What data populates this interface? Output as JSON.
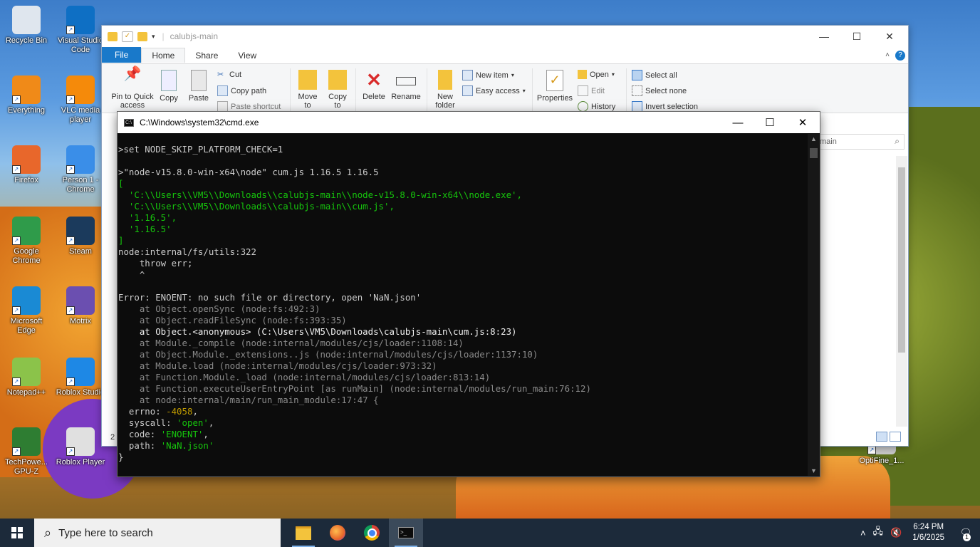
{
  "desktop": {
    "icons": [
      {
        "label": "Recycle Bin",
        "icon": "recycle-bin-icon",
        "color": "#dfe6ee"
      },
      {
        "label": "Visual Studio Code",
        "icon": "vscode-icon",
        "color": "#0e6fc4"
      },
      {
        "label": "Everything",
        "icon": "everything-search-icon",
        "color": "#f08a18"
      },
      {
        "label": "VLC media player",
        "icon": "vlc-icon",
        "color": "#f58a0a"
      },
      {
        "label": "Firefox",
        "icon": "firefox-icon",
        "color": "#e8672b"
      },
      {
        "label": "Person 1 - Chrome",
        "icon": "chrome-profile-icon",
        "color": "#3a8ee8"
      },
      {
        "label": "Google Chrome",
        "icon": "chrome-icon",
        "color": "#2f9b4a"
      },
      {
        "label": "Steam",
        "icon": "steam-icon",
        "color": "#1b3a5c"
      },
      {
        "label": "Microsoft Edge",
        "icon": "edge-icon",
        "color": "#1a8ad4"
      },
      {
        "label": "Motrix",
        "icon": "motrix-icon",
        "color": "#6b4fb0"
      },
      {
        "label": "Notepad++",
        "icon": "notepadpp-icon",
        "color": "#8bc34a"
      },
      {
        "label": "Roblox Studio",
        "icon": "roblox-studio-icon",
        "color": "#1e88e5"
      },
      {
        "label": "TechPowe... GPU-Z",
        "icon": "gpuz-icon",
        "color": "#2e7d32"
      },
      {
        "label": "Roblox Player",
        "icon": "roblox-player-icon",
        "color": "#e0e0e0"
      },
      {
        "label": "OptiFine_1...",
        "icon": "optifine-icon",
        "color": "#c9c9c9"
      }
    ]
  },
  "explorer": {
    "title": "calubjs-main",
    "tabs": {
      "file": "File",
      "home": "Home",
      "share": "Share",
      "view": "View"
    },
    "ribbon": {
      "pin": "Pin to Quick access",
      "copy": "Copy",
      "paste": "Paste",
      "cut": "Cut",
      "copy_path": "Copy path",
      "paste_shortcut": "Paste shortcut",
      "move_to": "Move to",
      "copy_to": "Copy to",
      "delete": "Delete",
      "rename": "Rename",
      "new_folder": "New folder",
      "new_item": "New item",
      "easy_access": "Easy access",
      "properties": "Properties",
      "open": "Open",
      "edit": "Edit",
      "history": "History",
      "select_all": "Select all",
      "select_none": "Select none",
      "invert_selection": "Invert selection"
    },
    "search_text": "main",
    "status_text": "2"
  },
  "cmd": {
    "title": "C:\\Windows\\system32\\cmd.exe",
    "lines": [
      {
        "text": ">set NODE_SKIP_PLATFORM_CHECK=1",
        "style": "normal"
      },
      {
        "text": "",
        "style": "normal"
      },
      {
        "text": ">\"node-v15.8.0-win-x64\\node\" cum.js 1.16.5 1.16.5",
        "style": "normal"
      },
      {
        "text": "[",
        "style": "green"
      },
      {
        "text": "  'C:\\\\Users\\\\VM5\\\\Downloads\\\\calubjs-main\\\\node-v15.8.0-win-x64\\\\node.exe',",
        "style": "green"
      },
      {
        "text": "  'C:\\\\Users\\\\VM5\\\\Downloads\\\\calubjs-main\\\\cum.js',",
        "style": "green"
      },
      {
        "text": "  '1.16.5',",
        "style": "green"
      },
      {
        "text": "  '1.16.5'",
        "style": "green"
      },
      {
        "text": "]",
        "style": "green"
      },
      {
        "text": "node:internal/fs/utils:322",
        "style": "normal"
      },
      {
        "text": "    throw err;",
        "style": "normal"
      },
      {
        "text": "    ^",
        "style": "normal"
      },
      {
        "text": "",
        "style": "normal"
      },
      {
        "text": "Error: ENOENT: no such file or directory, open 'NaN.json'",
        "style": "normal"
      },
      {
        "text": "    at Object.openSync (node:fs:492:3)",
        "style": "dim"
      },
      {
        "text": "    at Object.readFileSync (node:fs:393:35)",
        "style": "dim"
      },
      {
        "text": "    at Object.<anonymous> (C:\\Users\\VM5\\Downloads\\calubjs-main\\cum.js:8:23)",
        "style": "bright"
      },
      {
        "text": "    at Module._compile (node:internal/modules/cjs/loader:1108:14)",
        "style": "dim"
      },
      {
        "text": "    at Object.Module._extensions..js (node:internal/modules/cjs/loader:1137:10)",
        "style": "dim"
      },
      {
        "text": "    at Module.load (node:internal/modules/cjs/loader:973:32)",
        "style": "dim"
      },
      {
        "text": "    at Function.Module._load (node:internal/modules/cjs/loader:813:14)",
        "style": "dim"
      },
      {
        "text": "    at Function.executeUserEntryPoint [as runMain] (node:internal/modules/run_main:76:12)",
        "style": "dim"
      },
      {
        "text": "    at node:internal/main/run_main_module:17:47 {",
        "style": "dim"
      },
      {
        "text": "  errno: -4058,",
        "style": "errno"
      },
      {
        "text": "  syscall: 'open',",
        "style": "syscall"
      },
      {
        "text": "  code: 'ENOENT',",
        "style": "code"
      },
      {
        "text": "  path: 'NaN.json'",
        "style": "path"
      },
      {
        "text": "}",
        "style": "normal"
      }
    ]
  },
  "taskbar": {
    "search_placeholder": "Type here to search",
    "time": "6:24 PM",
    "date": "1/6/2025",
    "notification_count": "1"
  },
  "colors": {
    "accent": "#1979ca",
    "terminal_bg": "#0c0c0c",
    "terminal_text": "#cccccc",
    "terminal_green": "#16c60c",
    "terminal_yellow": "#c19c00",
    "taskbar_bg": "#1c2a3a"
  }
}
